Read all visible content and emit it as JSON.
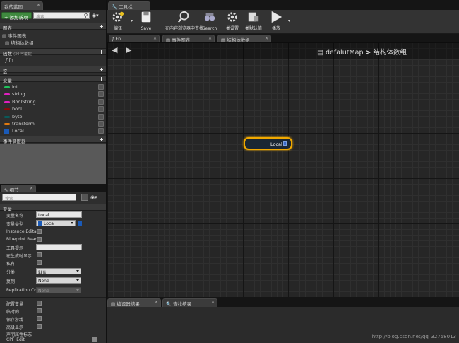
{
  "left_panel": {
    "tab_title": "我的蓝图",
    "add_new_label": "添加新项",
    "search_placeholder": "搜索",
    "sections": {
      "graphs": "图表",
      "event_graph": "事件图表",
      "struct_graph": "结构体数组",
      "functions": "函数",
      "functions_note": "(30 可覆载)",
      "fn_item": "fn",
      "macros": "宏",
      "variables": "变量",
      "dispatchers": "事件调度器"
    },
    "variables": [
      {
        "name": "int",
        "color": "#1fc25c"
      },
      {
        "name": "string",
        "color": "#e020c0"
      },
      {
        "name": "BoolString",
        "color": "#e020c0"
      },
      {
        "name": "bool",
        "color": "#8a0a0a"
      },
      {
        "name": "byte",
        "color": "#0a5a5a"
      },
      {
        "name": "transform",
        "color": "#e07a10"
      },
      {
        "name": "Local",
        "color": "#1a5ab8"
      }
    ]
  },
  "details_panel": {
    "tab_title": "细节",
    "search_placeholder": "搜索",
    "section_variable": "变量",
    "props": {
      "var_name_label": "变量名称",
      "var_name_value": "Local",
      "var_type_label": "变量类型",
      "var_type_value": "Local",
      "instance_editable": "Instance Editat",
      "blueprint_readonly": "Blueprint Read",
      "tooltip_label": "工具提示",
      "expose_on_spawn": "在生成时显示",
      "private_label": "私有",
      "category_label": "分类",
      "category_value": "默认",
      "replication_label": "复制",
      "replication_value": "None",
      "replication_cond_label": "Replication Cor",
      "replication_cond_value": "None",
      "config_var": "配置变量",
      "transient": "临时的",
      "save_game": "保存游戏",
      "advanced_display": "高级显示",
      "deprecated": "声明属性标志",
      "cpf_edit": "CPF_Edit"
    }
  },
  "toolbar": {
    "tab_title": "工具栏",
    "buttons": [
      {
        "label": "编译"
      },
      {
        "label": "Save"
      },
      {
        "label": "在内容浏览器中查找"
      },
      {
        "label": "Search"
      },
      {
        "label": "类设置"
      },
      {
        "label": "类默认值"
      },
      {
        "label": "播放"
      }
    ]
  },
  "graph_tabs": [
    {
      "label": "Fn"
    },
    {
      "label": "事件图表"
    },
    {
      "label": "结构体数组"
    }
  ],
  "breadcrumb": {
    "root": "defalutMap",
    "separator": ">",
    "current": "结构体数组"
  },
  "node": {
    "label": "Local"
  },
  "bottom_tabs": [
    {
      "label": "编译器结果"
    },
    {
      "label": "查找结果"
    }
  ],
  "watermark": "http://blog.csdn.net/qq_32758013"
}
